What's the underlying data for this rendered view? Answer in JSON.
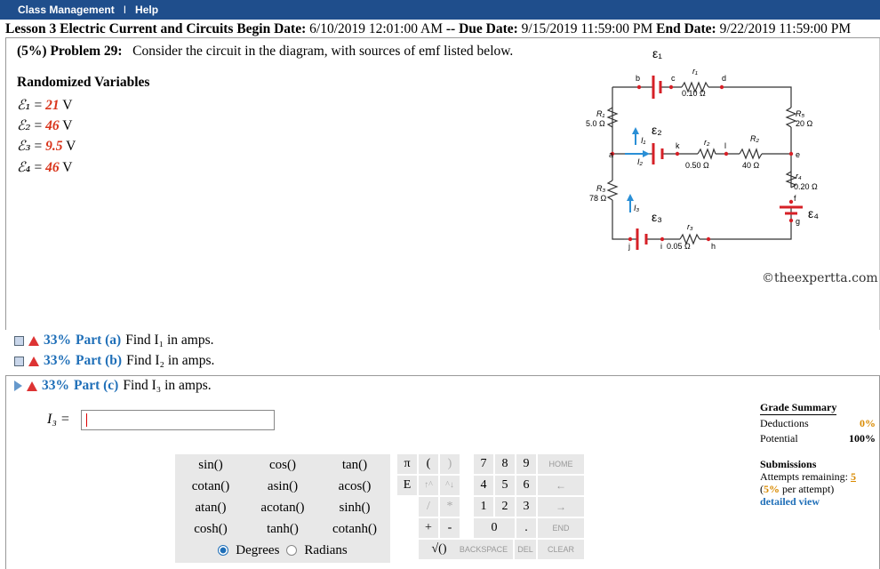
{
  "topbar": {
    "class_management": "Class Management",
    "separator": "I",
    "help": "Help"
  },
  "lesson": {
    "title": "Lesson 3 Electric Current and Circuits",
    "begin_label": "Begin Date:",
    "begin": "6/10/2019 12:01:00 AM",
    "sep": "--",
    "due_label": "Due Date:",
    "due": "9/15/2019 11:59:00 PM",
    "end_label": "End Date:",
    "end": "9/22/2019 11:59:00 PM"
  },
  "problem": {
    "header": "(5%) Problem 29:",
    "text": "Consider the circuit in the diagram, with sources of emf listed below."
  },
  "randomized": {
    "title": "Randomized Variables",
    "vars": [
      {
        "sym": "ℰ₁",
        "val": "21",
        "unit": "V"
      },
      {
        "sym": "ℰ₂",
        "val": "46",
        "unit": "V"
      },
      {
        "sym": "ℰ₃",
        "val": "9.5",
        "unit": "V"
      },
      {
        "sym": "ℰ₄",
        "val": "46",
        "unit": "V"
      }
    ]
  },
  "diagram": {
    "labels": {
      "b": "b",
      "c": "c",
      "d": "d",
      "e": "e",
      "f": "f",
      "g": "g",
      "h": "h",
      "i": "i",
      "j": "j",
      "k": "k",
      "l": "l",
      "a": "a",
      "E1": "ε₁",
      "E2": "ε₂",
      "E3": "ε₃",
      "E4": "ε₄",
      "r1": "r₁",
      "r1v": "0.10 Ω",
      "r2": "r₂",
      "r2v": "0.50 Ω",
      "r3": "r₃",
      "r3v": "0.05 Ω",
      "r4": "r₄",
      "r4v": "0.20 Ω",
      "R1": "R₁",
      "R1v": "5.0 Ω",
      "R2": "R₂",
      "R2v": "40 Ω",
      "R3": "R₃",
      "R3v": "78 Ω",
      "R5": "R₅",
      "R5v": "20 Ω",
      "I1": "I₁",
      "I2": "I₂",
      "I3": "I₃"
    },
    "copyright": "©theexpertta.com"
  },
  "parts": [
    {
      "pct": "33%",
      "name": "Part (a)",
      "text": "Find I₁ in amps."
    },
    {
      "pct": "33%",
      "name": "Part (b)",
      "text": "Find I₂ in amps."
    },
    {
      "pct": "33%",
      "name": "Part (c)",
      "text": "Find I₃ in amps."
    }
  ],
  "answer": {
    "label": "I₃ =",
    "value": ""
  },
  "functions": [
    [
      "sin()",
      "cos()",
      "tan()"
    ],
    [
      "cotan()",
      "asin()",
      "acos()"
    ],
    [
      "atan()",
      "acotan()",
      "sinh()"
    ],
    [
      "cosh()",
      "tanh()",
      "cotanh()"
    ]
  ],
  "angle": {
    "degrees": "Degrees",
    "radians": "Radians",
    "selected": "Degrees"
  },
  "keypad": {
    "pi": "π",
    "lparen": "(",
    "rparen": ")",
    "E": "E",
    "up1": "↑^",
    "up2": "^↓",
    "div": "/",
    "mul": "*",
    "plus": "+",
    "minus": "-",
    "sqrt": "√()",
    "digits": [
      "7",
      "8",
      "9",
      "4",
      "5",
      "6",
      "1",
      "2",
      "3",
      "0",
      "."
    ],
    "home": "HOME",
    "back_arrow": "←",
    "fwd_arrow": "→",
    "end": "END",
    "backspace": "BACKSPACE",
    "del": "DEL",
    "clear": "CLEAR"
  },
  "grade": {
    "title": "Grade Summary",
    "deductions_label": "Deductions",
    "deductions": "0%",
    "potential_label": "Potential",
    "potential": "100%"
  },
  "submissions": {
    "title": "Submissions",
    "attempts_label": "Attempts remaining:",
    "attempts": "5",
    "per_attempt_pre": "(",
    "per_attempt_pct": "5%",
    "per_attempt_post": "per attempt)",
    "detailed": "detailed view"
  }
}
